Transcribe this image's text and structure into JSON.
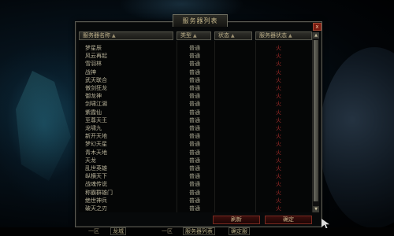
{
  "window": {
    "title": "服务器列表",
    "close_label": "x",
    "headers": [
      {
        "label": "服务器名称",
        "arrow": "▲"
      },
      {
        "label": "类型",
        "arrow": "▲"
      },
      {
        "label": "状态",
        "arrow": "▲"
      },
      {
        "label": "服务器状态",
        "arrow": "▲"
      }
    ],
    "rows": [
      {
        "name": "梦星辰",
        "type": "普通",
        "status": "火"
      },
      {
        "name": "风云再起",
        "type": "普通",
        "status": "火"
      },
      {
        "name": "雪羽林",
        "type": "普通",
        "status": "火"
      },
      {
        "name": "战神",
        "type": "普通",
        "status": "火"
      },
      {
        "name": "武天联合",
        "type": "普通",
        "status": "火"
      },
      {
        "name": "傲剑狂龙",
        "type": "普通",
        "status": "火"
      },
      {
        "name": "御龙神",
        "type": "普通",
        "status": "火"
      },
      {
        "name": "剑啸江湖",
        "type": "普通",
        "status": "火"
      },
      {
        "name": "紫霞仙",
        "type": "普通",
        "status": "火"
      },
      {
        "name": "至尊天王",
        "type": "普通",
        "status": "火"
      },
      {
        "name": "龙啸九",
        "type": "普通",
        "status": "火"
      },
      {
        "name": "新开天地",
        "type": "普通",
        "status": "火"
      },
      {
        "name": "梦幻天星",
        "type": "普通",
        "status": "火"
      },
      {
        "name": "青木天地",
        "type": "普通",
        "status": "火"
      },
      {
        "name": "天龙",
        "type": "普通",
        "status": "火"
      },
      {
        "name": "乱世英雄",
        "type": "普通",
        "status": "火"
      },
      {
        "name": "纵横天下",
        "type": "普通",
        "status": "火"
      },
      {
        "name": "战魂传说",
        "type": "普通",
        "status": "火"
      },
      {
        "name": "称霸群雄门",
        "type": "普通",
        "status": "火"
      },
      {
        "name": "绝世神兵",
        "type": "普通",
        "status": "火"
      },
      {
        "name": "破天之刃",
        "type": "普通",
        "status": "火"
      }
    ],
    "btn_refresh": "刷新",
    "btn_confirm": "确定"
  },
  "bottom_bar": {
    "item1": "一区",
    "item2": "龙城",
    "item3": "一区",
    "item4": "服务器列表",
    "item5": "确定服"
  },
  "colors": {
    "accent": "#7a2a20",
    "status_red": "#9a2a28",
    "text_gold": "#c8b98c"
  }
}
